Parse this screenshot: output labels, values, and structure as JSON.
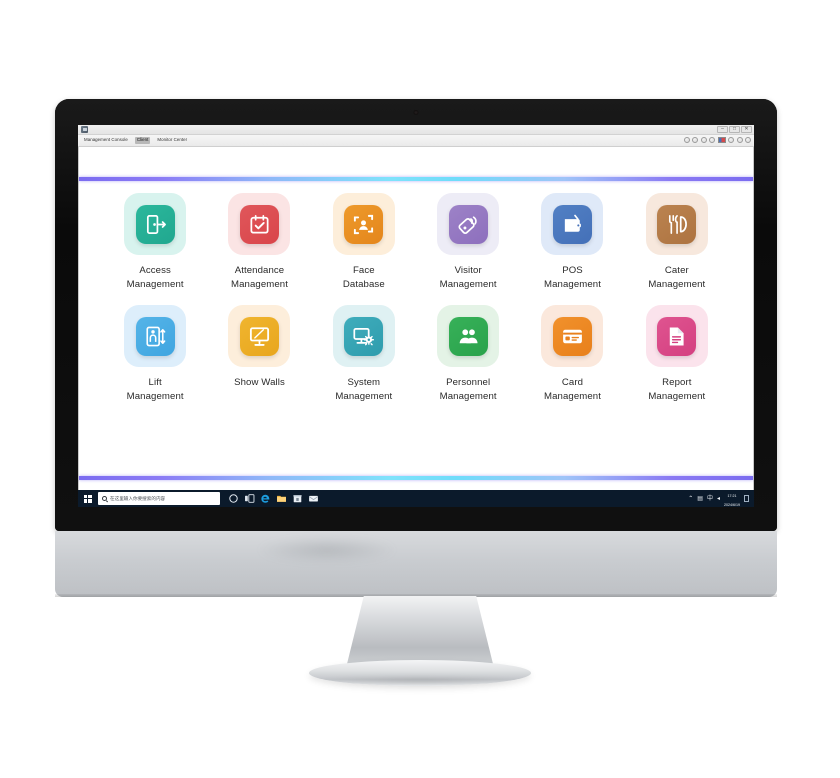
{
  "window": {
    "app_icon": "app-window-icon",
    "menu_items": [
      {
        "label": "Management Console",
        "active": false
      },
      {
        "label": "Client",
        "active": true
      },
      {
        "label": "Monitor Center",
        "active": false
      }
    ],
    "controls": [
      {
        "name": "minimize-button",
        "glyph": "–"
      },
      {
        "name": "maximize-button",
        "glyph": "□"
      },
      {
        "name": "close-button",
        "glyph": "✕"
      }
    ],
    "toolbar_icons": [
      "globe-icon",
      "refresh-icon",
      "home-icon",
      "shield-icon",
      "flag-icon",
      "power-icon",
      "help-icon",
      "settings-icon"
    ]
  },
  "theme": {
    "gradient_start": "#7b6cf0",
    "gradient_mid": "#7fe2fb",
    "gradient_end": "#7b6cf0",
    "taskbar_bg": "#0b1a2b"
  },
  "main": {
    "rows": [
      [
        {
          "label": "Access\nManagement",
          "icon": "door-access-icon",
          "outer_color": "#d8f3ee",
          "inner_color": "#21a78f",
          "inner_color2": "#2bb89c"
        },
        {
          "label": "Attendance\nManagement",
          "icon": "calendar-check-icon",
          "outer_color": "#fbe4e4",
          "inner_color": "#d9454a",
          "inner_color2": "#e0575b"
        },
        {
          "label": "Face\nDatabase",
          "icon": "face-scan-icon",
          "outer_color": "#fdeeda",
          "inner_color": "#e4861c",
          "inner_color2": "#ee9a2b"
        },
        {
          "label": "Visitor\nManagement",
          "icon": "visitor-badge-icon",
          "outer_color": "#edecf6",
          "inner_color": "#8d6fbd",
          "inner_color2": "#9d82c7"
        },
        {
          "label": "POS\nManagement",
          "icon": "wallet-icon",
          "outer_color": "#dfe9f8",
          "inner_color": "#4470b8",
          "inner_color2": "#5280c4"
        },
        {
          "label": "Cater\nManagement",
          "icon": "cutlery-icon",
          "outer_color": "#f7e8dd",
          "inner_color": "#ad7340",
          "inner_color2": "#bb8350"
        }
      ],
      [
        {
          "label": "Lift\nManagement",
          "icon": "elevator-icon",
          "outer_color": "#ddeefb",
          "inner_color": "#3fa5e0",
          "inner_color2": "#55b4e8"
        },
        {
          "label": "Show Walls",
          "icon": "display-screen-icon",
          "outer_color": "#fdeedb",
          "inner_color": "#e8a61e",
          "inner_color2": "#f0b52f"
        },
        {
          "label": "System\nManagement",
          "icon": "monitor-gear-icon",
          "outer_color": "#dff1f3",
          "inner_color": "#2f9cad",
          "inner_color2": "#3fadbc"
        },
        {
          "label": "Personnel\nManagement",
          "icon": "people-group-icon",
          "outer_color": "#e4f3e6",
          "inner_color": "#2aa24b",
          "inner_color2": "#37b159"
        },
        {
          "label": "Card\nManagement",
          "icon": "id-card-icon",
          "outer_color": "#fbe8dc",
          "inner_color": "#e8801b",
          "inner_color2": "#f1912c"
        },
        {
          "label": "Report\nManagement",
          "icon": "document-report-icon",
          "outer_color": "#fbe3ec",
          "inner_color": "#d44080",
          "inner_color2": "#df5490"
        }
      ]
    ]
  },
  "taskbar": {
    "start_label": "windows-start",
    "search_placeholder": "在这里输入你要搜索的内容",
    "pinned": [
      {
        "name": "cortana-icon"
      },
      {
        "name": "task-view-icon"
      },
      {
        "name": "edge-browser-icon"
      },
      {
        "name": "file-explorer-icon"
      },
      {
        "name": "microsoft-store-icon"
      },
      {
        "name": "mail-icon"
      }
    ],
    "tray": {
      "overflow": "⌃",
      "network": "▤",
      "input": "中",
      "volume": "◂",
      "time": "17:21",
      "date": "2024/6/19"
    }
  }
}
